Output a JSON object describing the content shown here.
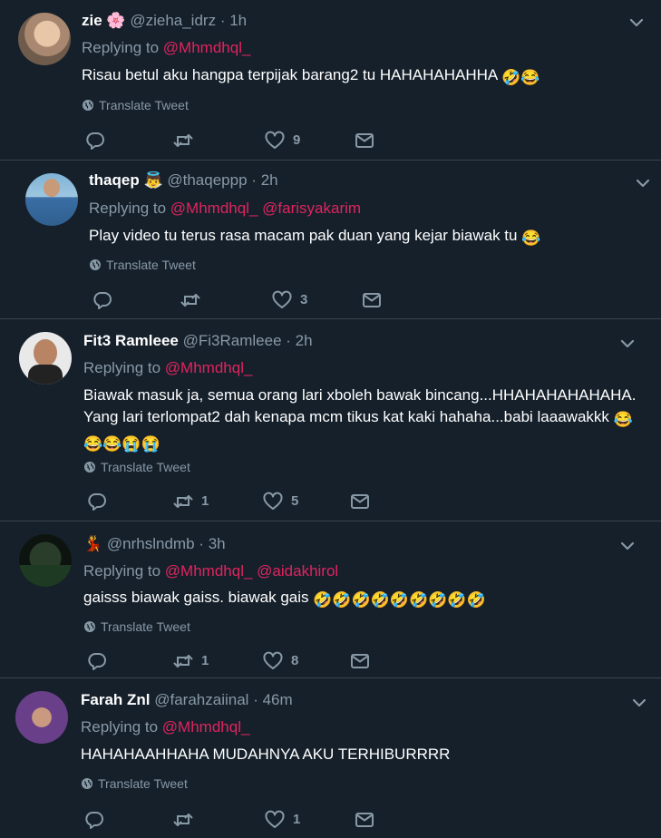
{
  "tweets": [
    {
      "name": "zie",
      "name_emoji": "🌸",
      "handle": "@zieha_idrz",
      "time": "1h",
      "replying_label": "Replying to",
      "mentions": [
        "@Mhmdhql_"
      ],
      "text": "Risau betul aku hangpa terpijak barang2 tu HAHAHAHAHHA",
      "text_emojis": "🤣😂",
      "translate": "Translate Tweet",
      "replies": "",
      "retweets": "",
      "likes": "9"
    },
    {
      "name": "thaqep",
      "name_emoji": "👼",
      "handle": "@thaqeppp",
      "time": "2h",
      "replying_label": "Replying to",
      "mentions": [
        "@Mhmdhql_",
        "@farisyakarim"
      ],
      "text": "Play video tu terus rasa macam pak duan yang kejar biawak tu",
      "text_emojis": "😂",
      "translate": "Translate Tweet",
      "replies": "",
      "retweets": "",
      "likes": "3"
    },
    {
      "name": "Fit3 Ramleee",
      "name_emoji": "",
      "handle": "@Fi3Ramleee",
      "time": "2h",
      "replying_label": "Replying to",
      "mentions": [
        "@Mhmdhql_"
      ],
      "text_line1": "Biawak masuk ja, semua orang lari xboleh bawak bincang...HHAHAHAHAHAHA.",
      "text_line2": "Yang lari terlompat2 dah kenapa mcm tikus kat kaki hahaha...babi laaawakkk",
      "text_line2_emoji": "😂",
      "text_line3_emojis": "😂😂😭😭",
      "translate": "Translate Tweet",
      "replies": "",
      "retweets": "1",
      "likes": "5"
    },
    {
      "name": "",
      "name_emoji": "💃",
      "handle": "@nrhslndmb",
      "time": "3h",
      "replying_label": "Replying to",
      "mentions": [
        "@Mhmdhql_",
        "@aidakhirol"
      ],
      "text": "gaisss biawak gaiss. biawak gais",
      "text_emojis": "🤣🤣🤣🤣🤣🤣🤣🤣🤣",
      "translate": "Translate Tweet",
      "replies": "",
      "retweets": "1",
      "likes": "8"
    },
    {
      "name": "Farah Znl",
      "name_emoji": "",
      "handle": "@farahzaiinal",
      "time": "46m",
      "replying_label": "Replying to",
      "mentions": [
        "@Mhmdhql_"
      ],
      "text": "HAHAHAAHHAHA MUDAHNYA AKU TERHIBURRRR",
      "text_emojis": "",
      "translate": "Translate Tweet",
      "replies": "",
      "retweets": "",
      "likes": "1"
    }
  ],
  "separator": "·",
  "icons": {
    "more": "chevron-down-icon",
    "reply": "reply-icon",
    "retweet": "retweet-icon",
    "like": "heart-icon",
    "dm": "envelope-icon",
    "translate": "globe-icon"
  },
  "colors": {
    "background": "#15202b",
    "divider": "#38444d",
    "secondary_text": "#8899a6",
    "mention": "#e0245e"
  }
}
